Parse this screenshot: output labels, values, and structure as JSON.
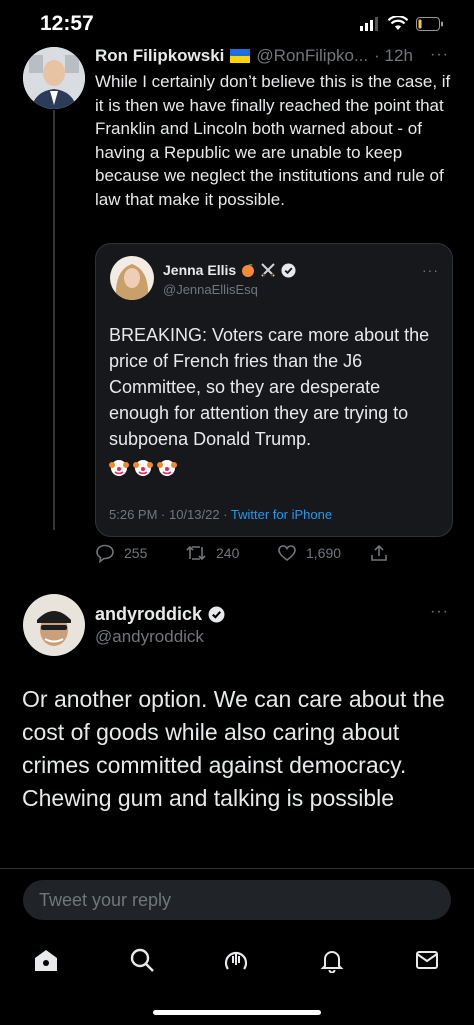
{
  "status_bar": {
    "time": "12:57"
  },
  "parent_tweet": {
    "name": "Ron Filipkowski",
    "handle": "@RonFilipko...",
    "time": "· 12h",
    "body": "While I certainly don’t believe this is the case, if it is then we have finally reached the point that Franklin and Lincoln both warned about - of having a Republic we are unable to keep because we neglect the institutions and rule of law that make it possible."
  },
  "quoted_tweet": {
    "name": "Jenna Ellis",
    "handle": "@JennaEllisEsq",
    "body": "BREAKING: Voters care more about the price of French fries than the J6 Committee, so they are desperate enough for attention they are trying to subpoena Donald Trump.",
    "timestamp": "5:26 PM · 10/13/22 ·",
    "source": "Twitter for iPhone"
  },
  "actions": {
    "replies": "255",
    "retweets": "240",
    "likes": "1,690"
  },
  "main_tweet": {
    "name": "andyroddick",
    "handle": "@andyroddick",
    "body": "Or another option.  We can care about the cost of goods while also caring about crimes committed against democracy. Chewing gum and talking is possible"
  },
  "reply": {
    "placeholder": "Tweet your reply"
  },
  "colors": {
    "accent": "#1d9bf0",
    "background": "#000000",
    "muted": "#71767b"
  },
  "tabbar": [
    "home-icon",
    "search-icon",
    "spaces-icon",
    "notifications-icon",
    "messages-icon"
  ]
}
